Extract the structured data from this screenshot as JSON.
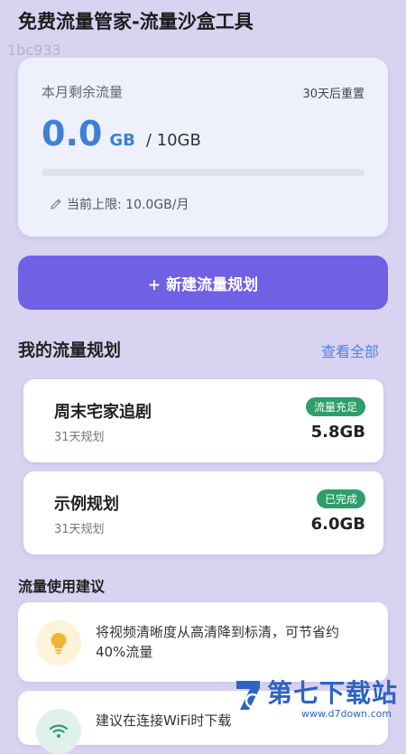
{
  "app": {
    "title": "免费流量管家-流量沙盒工具",
    "watermark_id": "1bc933"
  },
  "quota": {
    "label": "本月剩余流量",
    "reset_text": "30天后重置",
    "amount": "0.0",
    "unit": "GB",
    "total": "/ 10GB",
    "progress_fraction": 0.0,
    "limit_text": "当前上限: 10.0GB/月",
    "accent_color": "#3f7fd6"
  },
  "actions": {
    "new_plan_label": "+ 新建流量规划"
  },
  "plans_section": {
    "title": "我的流量规划",
    "view_all_label": "查看全部",
    "items": [
      {
        "name": "周末宅家追剧",
        "days": "31天规划",
        "badge": "流量充足",
        "amount": "5.8GB"
      },
      {
        "name": "示例规划",
        "days": "31天规划",
        "badge": "已完成",
        "amount": "6.0GB"
      }
    ]
  },
  "tips_section": {
    "title": "流量使用建议",
    "items": [
      {
        "icon": "lightbulb-icon",
        "text": "将视频清晰度从高清降到标清，可节省约40%流量"
      },
      {
        "icon": "wifi-icon",
        "text": "建议在连接WiFi时下载"
      }
    ]
  },
  "logo": {
    "text": "第七下载站",
    "url": "www.d7down.com"
  }
}
